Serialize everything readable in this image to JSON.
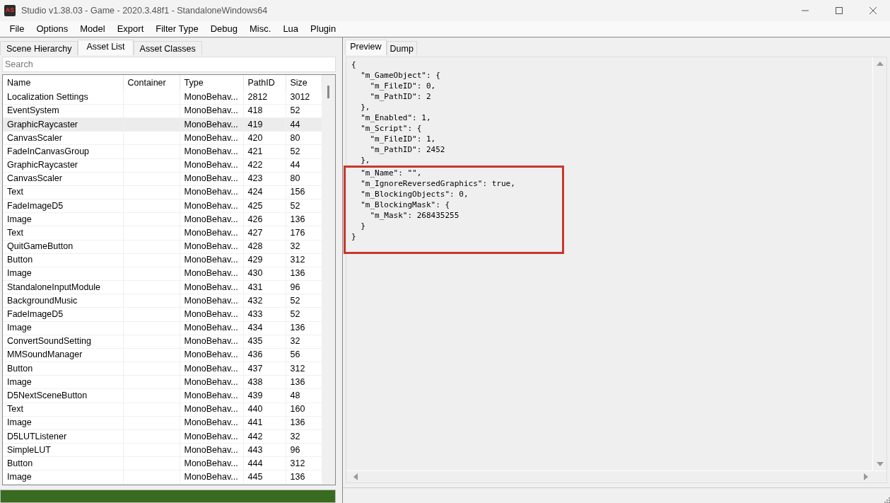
{
  "window": {
    "app_icon_text": "AS",
    "title": "Studio v1.38.03 - Game - 2020.3.48f1 - StandaloneWindows64"
  },
  "menu": [
    "File",
    "Options",
    "Model",
    "Export",
    "Filter Type",
    "Debug",
    "Misc.",
    "Lua",
    "Plugin"
  ],
  "left_tabs": [
    {
      "label": "Scene Hierarchy",
      "selected": false
    },
    {
      "label": "Asset List",
      "selected": true
    },
    {
      "label": "Asset Classes",
      "selected": false
    }
  ],
  "search": {
    "placeholder": "Search"
  },
  "table": {
    "columns": [
      "Name",
      "Container",
      "Type",
      "PathID",
      "Size"
    ],
    "rows": [
      {
        "name": "Localization Settings",
        "type": "MonoBehav...",
        "path_id": "2812",
        "size": "3012",
        "selected": false
      },
      {
        "name": "EventSystem",
        "type": "MonoBehav...",
        "path_id": "418",
        "size": "52",
        "selected": false
      },
      {
        "name": "GraphicRaycaster",
        "type": "MonoBehav...",
        "path_id": "419",
        "size": "44",
        "selected": true
      },
      {
        "name": "CanvasScaler",
        "type": "MonoBehav...",
        "path_id": "420",
        "size": "80",
        "selected": false
      },
      {
        "name": "FadeInCanvasGroup",
        "type": "MonoBehav...",
        "path_id": "421",
        "size": "52",
        "selected": false
      },
      {
        "name": "GraphicRaycaster",
        "type": "MonoBehav...",
        "path_id": "422",
        "size": "44",
        "selected": false
      },
      {
        "name": "CanvasScaler",
        "type": "MonoBehav...",
        "path_id": "423",
        "size": "80",
        "selected": false
      },
      {
        "name": "Text",
        "type": "MonoBehav...",
        "path_id": "424",
        "size": "156",
        "selected": false
      },
      {
        "name": "FadeImageD5",
        "type": "MonoBehav...",
        "path_id": "425",
        "size": "52",
        "selected": false
      },
      {
        "name": "Image",
        "type": "MonoBehav...",
        "path_id": "426",
        "size": "136",
        "selected": false
      },
      {
        "name": "Text",
        "type": "MonoBehav...",
        "path_id": "427",
        "size": "176",
        "selected": false
      },
      {
        "name": "QuitGameButton",
        "type": "MonoBehav...",
        "path_id": "428",
        "size": "32",
        "selected": false
      },
      {
        "name": "Button",
        "type": "MonoBehav...",
        "path_id": "429",
        "size": "312",
        "selected": false
      },
      {
        "name": "Image",
        "type": "MonoBehav...",
        "path_id": "430",
        "size": "136",
        "selected": false
      },
      {
        "name": "StandaloneInputModule",
        "type": "MonoBehav...",
        "path_id": "431",
        "size": "96",
        "selected": false
      },
      {
        "name": "BackgroundMusic",
        "type": "MonoBehav...",
        "path_id": "432",
        "size": "52",
        "selected": false
      },
      {
        "name": "FadeImageD5",
        "type": "MonoBehav...",
        "path_id": "433",
        "size": "52",
        "selected": false
      },
      {
        "name": "Image",
        "type": "MonoBehav...",
        "path_id": "434",
        "size": "136",
        "selected": false
      },
      {
        "name": "ConvertSoundSetting",
        "type": "MonoBehav...",
        "path_id": "435",
        "size": "32",
        "selected": false
      },
      {
        "name": "MMSoundManager",
        "type": "MonoBehav...",
        "path_id": "436",
        "size": "56",
        "selected": false
      },
      {
        "name": "Button",
        "type": "MonoBehav...",
        "path_id": "437",
        "size": "312",
        "selected": false
      },
      {
        "name": "Image",
        "type": "MonoBehav...",
        "path_id": "438",
        "size": "136",
        "selected": false
      },
      {
        "name": "D5NextSceneButton",
        "type": "MonoBehav...",
        "path_id": "439",
        "size": "48",
        "selected": false
      },
      {
        "name": "Text",
        "type": "MonoBehav...",
        "path_id": "440",
        "size": "160",
        "selected": false
      },
      {
        "name": "Image",
        "type": "MonoBehav...",
        "path_id": "441",
        "size": "136",
        "selected": false
      },
      {
        "name": "D5LUTListener",
        "type": "MonoBehav...",
        "path_id": "442",
        "size": "32",
        "selected": false
      },
      {
        "name": "SimpleLUT",
        "type": "MonoBehav...",
        "path_id": "443",
        "size": "96",
        "selected": false
      },
      {
        "name": "Button",
        "type": "MonoBehav...",
        "path_id": "444",
        "size": "312",
        "selected": false
      },
      {
        "name": "Image",
        "type": "MonoBehav...",
        "path_id": "445",
        "size": "136",
        "selected": false
      }
    ]
  },
  "progress": {
    "level": 1
  },
  "right_tabs": [
    {
      "label": "Preview",
      "selected": true
    },
    {
      "label": "Dump",
      "selected": false
    }
  ],
  "preview_lines": [
    {
      "text": "{",
      "highlighted": false
    },
    {
      "text": "  \"m_GameObject\": {",
      "highlighted": false
    },
    {
      "text": "    \"m_FileID\": 0,",
      "highlighted": false
    },
    {
      "text": "    \"m_PathID\": 2",
      "highlighted": false
    },
    {
      "text": "  },",
      "highlighted": false
    },
    {
      "text": "  \"m_Enabled\": 1,",
      "highlighted": false
    },
    {
      "text": "  \"m_Script\": {",
      "highlighted": false
    },
    {
      "text": "    \"m_FileID\": 1,",
      "highlighted": false
    },
    {
      "text": "    \"m_PathID\": 2452",
      "highlighted": false
    },
    {
      "text": "  },",
      "highlighted": false
    },
    {
      "text": "  \"m_Name\": \"\",",
      "highlighted": true
    },
    {
      "text": "  \"m_IgnoreReversedGraphics\": true,",
      "highlighted": true
    },
    {
      "text": "  \"m_BlockingObjects\": 0,",
      "highlighted": true
    },
    {
      "text": "  \"m_BlockingMask\": {",
      "highlighted": true
    },
    {
      "text": "    \"m_Mask\": 268435255",
      "highlighted": true
    },
    {
      "text": "  }",
      "highlighted": true
    },
    {
      "text": "}",
      "highlighted": true
    }
  ]
}
